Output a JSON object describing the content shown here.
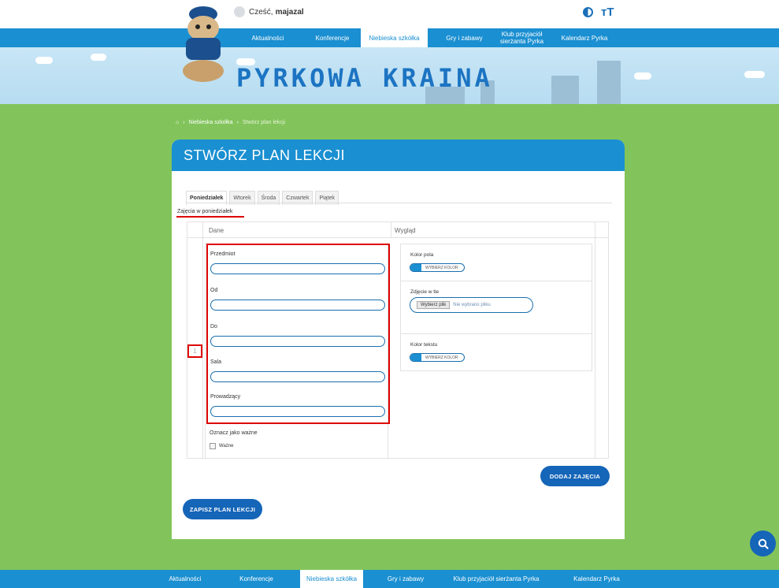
{
  "header": {
    "greeting": "Cześć,",
    "username": "majazal",
    "contrast_icon": "contrast-icon",
    "font_size_label": "TT"
  },
  "nav": [
    {
      "label": "Aktualności"
    },
    {
      "label": "Konferencje"
    },
    {
      "label": "Niebieska szkółka",
      "active": true
    },
    {
      "label": "Gry i zabawy"
    },
    {
      "label": "Klub przyjaciół sierżanta Pyrka"
    },
    {
      "label": "Kalendarz Pyrka"
    }
  ],
  "banner": {
    "title": "PYRKOWA KRAINA"
  },
  "breadcrumb": {
    "home_icon": "home-icon",
    "items": [
      "Niebieska szkółka",
      "Stwórz plan lekcji"
    ]
  },
  "page": {
    "title": "STWÓRZ PLAN LEKCJI",
    "tabs": [
      "Poniedziałek",
      "Wtorek",
      "Środa",
      "Czwartek",
      "Piątek"
    ],
    "active_tab": "Poniedziałek",
    "day_label": "Zajęcia w poniedziałek",
    "table": {
      "col_data": "Dane",
      "col_look": "Wygląd",
      "row_number": "1",
      "fields": [
        "Przedmiot",
        "Od",
        "Do",
        "Sala",
        "Prowadzący"
      ],
      "important_label": "Oznacz jako ważne",
      "important_checkbox": "Ważne",
      "field_color": "Kolor pola",
      "choose_color": "WYBIERZ KOLOR",
      "bg_image": "Zdjęcie w tle",
      "file_button": "Wybierz plik",
      "file_none": "Nie wybrano pliku",
      "text_color": "Kolor tekstu"
    },
    "add_button": "DODAJ ZAJĘCIA",
    "save_button": "ZAPISZ PLAN LEKCJI"
  },
  "footer": [
    {
      "label": "Aktualności"
    },
    {
      "label": "Konferencje"
    },
    {
      "label": "Niebieska szkółka",
      "active": true
    },
    {
      "label": "Gry i zabawy"
    },
    {
      "label": "Klub przyjaciół sierżanta Pyrka"
    },
    {
      "label": "Kalendarz Pyrka"
    }
  ],
  "colors": {
    "primary": "#1a8fd1",
    "button": "#1565b8",
    "background": "#82c45b",
    "highlight": "#dd0000"
  }
}
